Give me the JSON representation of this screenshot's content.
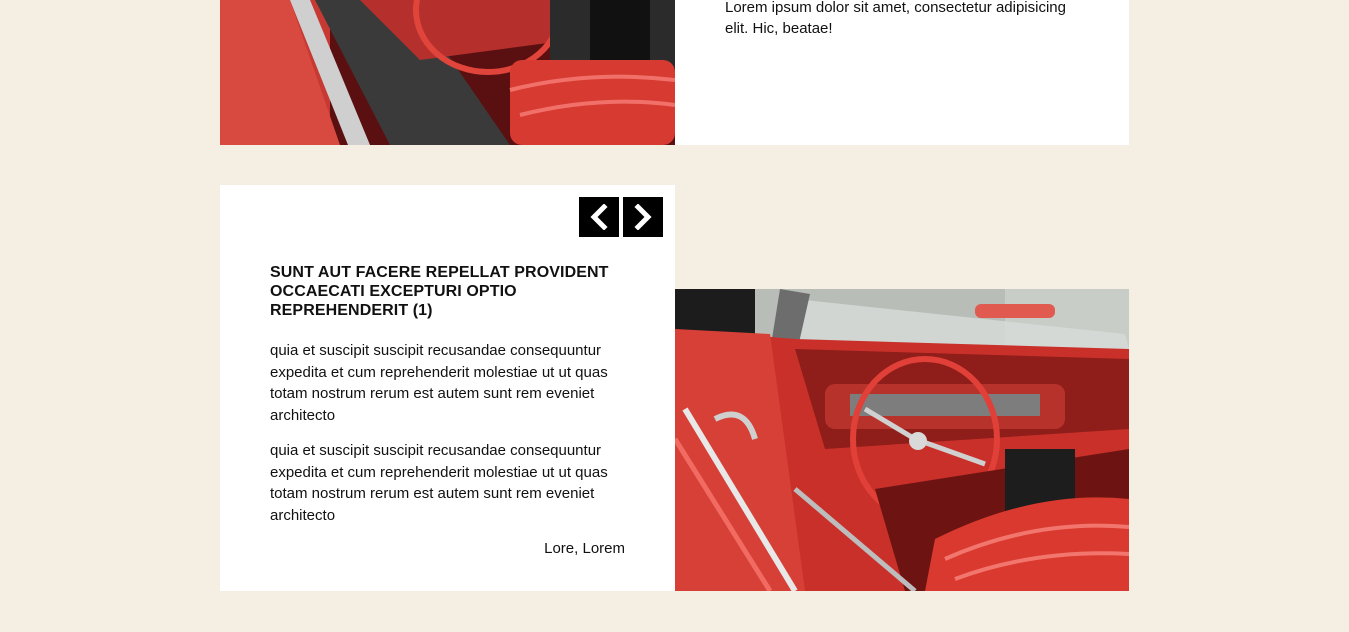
{
  "top_section": {
    "text": "Lorem ipsum dolor sit amet, consectetur adipisicing elit. Hic, beatae!"
  },
  "card": {
    "title": "SUNT AUT FACERE REPELLAT PROVIDENT OCCAECATI EXCEPTURI OPTIO REPREHENDERIT (1)",
    "paragraphs": [
      "quia et suscipit suscipit recusandae consequuntur expedita et cum reprehenderit molestiae ut ut quas totam nostrum rerum est autem sunt rem eveniet architecto",
      "quia et suscipit suscipit recusandae consequuntur expedita et cum reprehenderit molestiae ut ut quas totam nostrum rerum est autem sunt rem eveniet architecto"
    ],
    "author": "Lore, Lorem",
    "nav": {
      "prev_icon": "chevron-left-icon",
      "next_icon": "chevron-right-icon"
    }
  },
  "colors": {
    "background": "#f4efe2",
    "card": "#ffffff",
    "car_red": "#d8342c",
    "nav": "#000000"
  }
}
